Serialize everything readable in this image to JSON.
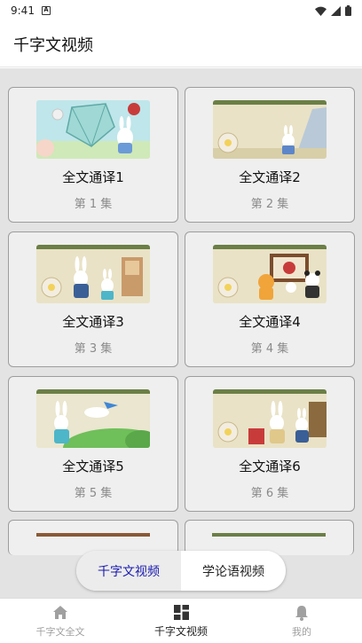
{
  "status_bar": {
    "time": "9:41"
  },
  "app_bar": {
    "title": "千字文视频"
  },
  "videos": [
    {
      "title": "全文通译1",
      "episode": "第 1 集"
    },
    {
      "title": "全文通译2",
      "episode": "第 2 集"
    },
    {
      "title": "全文通译3",
      "episode": "第 3 集"
    },
    {
      "title": "全文通译4",
      "episode": "第 4 集"
    },
    {
      "title": "全文通译5",
      "episode": "第 5 集"
    },
    {
      "title": "全文通译6",
      "episode": "第 6 集"
    }
  ],
  "toggle": {
    "active_label": "千字文视频",
    "inactive_label": "学论语视频"
  },
  "bottom_nav": [
    {
      "label": "千字文全文",
      "icon": "home-icon",
      "active": false
    },
    {
      "label": "千字文视频",
      "icon": "grid-icon",
      "active": true
    },
    {
      "label": "我的",
      "icon": "bell-icon",
      "active": false
    }
  ],
  "colors": {
    "accent": "#1a1ab0",
    "content_bg": "#e3e3e3",
    "card_border": "#9d9d9d"
  }
}
